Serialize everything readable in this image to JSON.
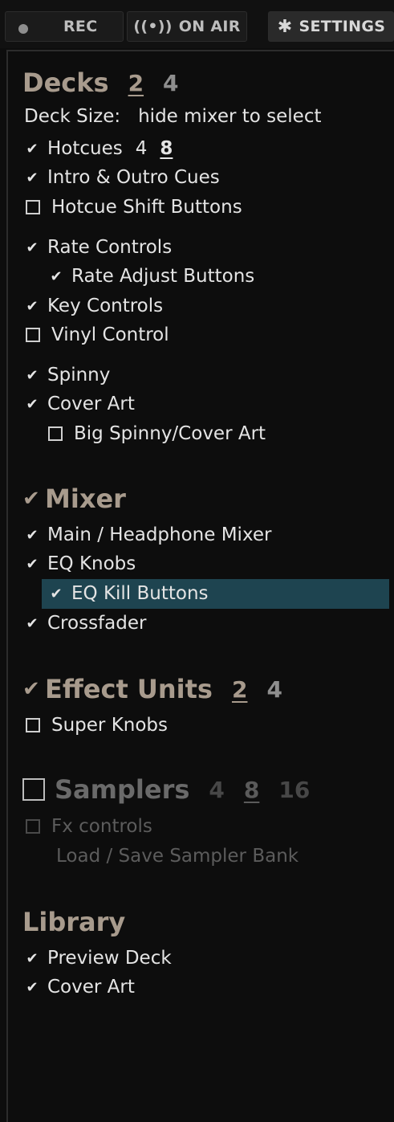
{
  "toolbar": {
    "rec_label": "REC",
    "onair_glyph": "((•))",
    "onair_label": "ON AIR",
    "settings_label": "SETTINGS",
    "accent_color": "#a89b8d",
    "highlight_color": "#1e4450"
  },
  "decks": {
    "title": "Decks",
    "count_options": [
      "2",
      "4"
    ],
    "selected_count": "2",
    "deck_size_label": "Deck Size:",
    "deck_size_value": "hide mixer to select",
    "hotcues_label": "Hotcues",
    "hotcues_options": [
      "4",
      "8"
    ],
    "hotcues_selected": "8",
    "intro_outro": "Intro & Outro Cues",
    "hotcue_shift": "Hotcue Shift Buttons",
    "rate_controls": "Rate Controls",
    "rate_adjust": "Rate Adjust Buttons",
    "key_controls": "Key Controls",
    "vinyl_control": "Vinyl Control",
    "spinny": "Spinny",
    "cover_art": "Cover Art",
    "big_spinny": "Big Spinny/Cover Art"
  },
  "mixer": {
    "title": "Mixer",
    "main_headphone": "Main / Headphone Mixer",
    "eq_knobs": "EQ Knobs",
    "eq_kill": "EQ Kill Buttons",
    "crossfader": "Crossfader"
  },
  "effects": {
    "title": "Effect Units",
    "count_options": [
      "2",
      "4"
    ],
    "selected_count": "2",
    "super_knobs": "Super Knobs"
  },
  "samplers": {
    "title": "Samplers",
    "count_options": [
      "4",
      "8",
      "16"
    ],
    "selected_count": "8",
    "fx_controls": "Fx controls",
    "load_save": "Load / Save Sampler Bank"
  },
  "library": {
    "title": "Library",
    "preview_deck": "Preview Deck",
    "cover_art": "Cover Art"
  },
  "glyphs": {
    "check": "✔"
  }
}
